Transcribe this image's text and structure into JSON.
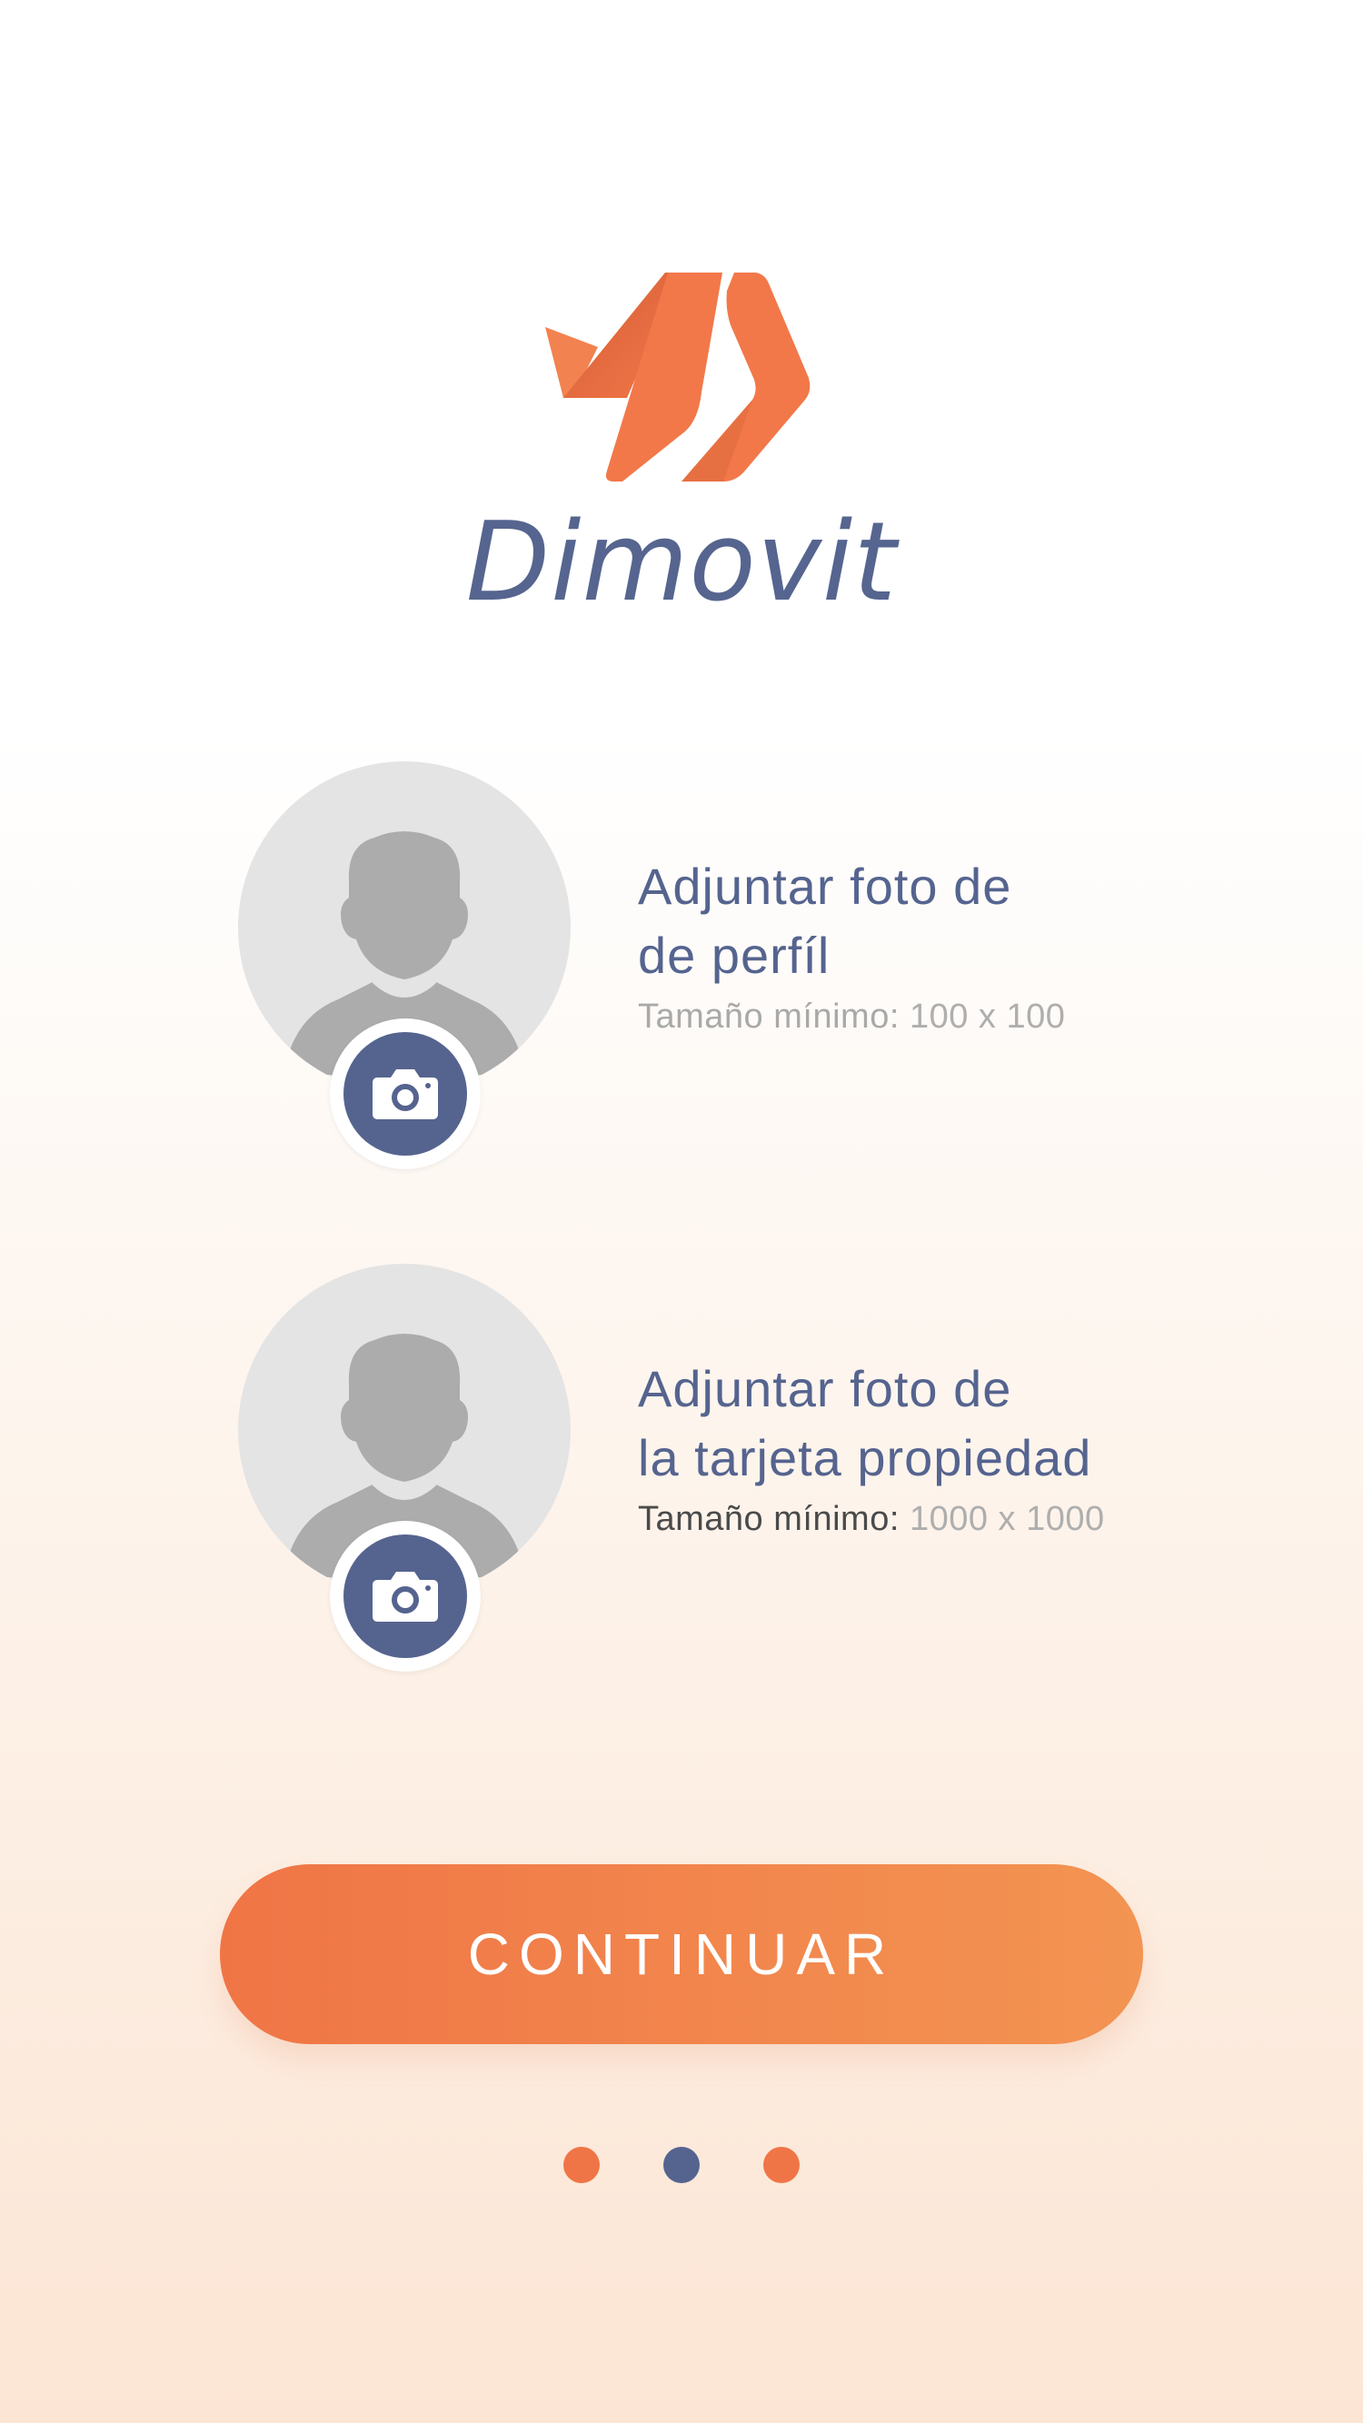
{
  "brand": {
    "name": "Dimovit",
    "logo_icon": "dimovit-logo-icon",
    "logo_color": "#f2784a",
    "name_color": "#56658f"
  },
  "uploads": [
    {
      "title_line1": "Adjuntar foto de",
      "title_line2": "de perfíl",
      "size_label": "Tamaño mínimo:",
      "size_value": "100 x 100",
      "placeholder_icon": "person-silhouette-icon",
      "action_icon": "camera-icon"
    },
    {
      "title_line1": "Adjuntar foto de",
      "title_line2": "la tarjeta propiedad",
      "size_label": "Tamaño mínimo:",
      "size_value": "1000 x 1000",
      "placeholder_icon": "person-silhouette-icon",
      "action_icon": "camera-icon"
    }
  ],
  "continue_button": {
    "label": "CONTINUAR",
    "gradient_start": "#f07546",
    "gradient_end": "#f39452"
  },
  "pager": {
    "total": 3,
    "active_index": 1,
    "active_color": "#55648f",
    "inactive_color": "#f07546"
  },
  "colors": {
    "accent": "#f07546",
    "primary": "#55648f"
  }
}
